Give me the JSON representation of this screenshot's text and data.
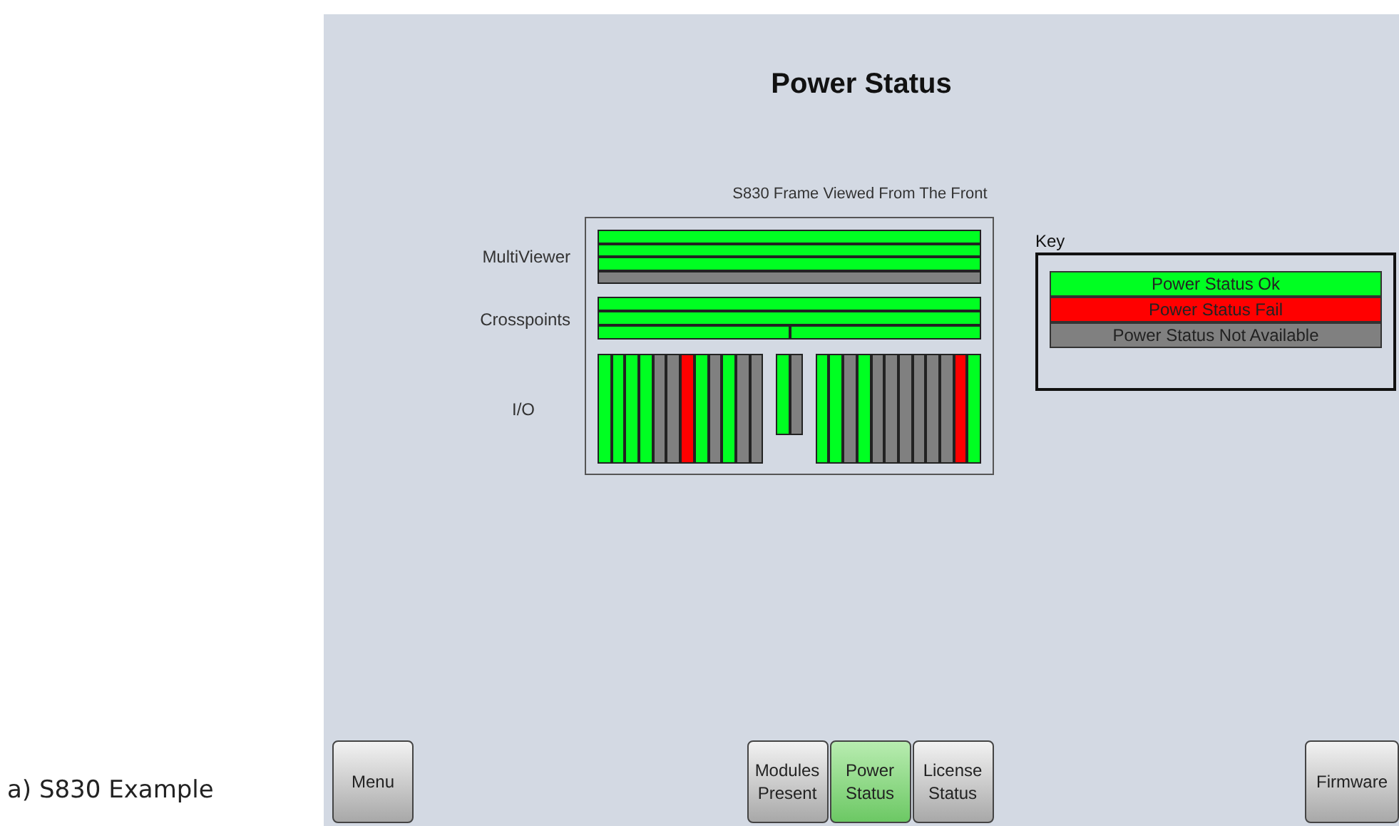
{
  "caption": "a) S830 Example",
  "title": "Power Status",
  "subtitle": "S830 Frame Viewed From The Front",
  "frame": {
    "multiviewer": {
      "label": "MultiViewer",
      "rows": [
        {
          "color": "#00ff22"
        },
        {
          "color": "#00ff22"
        },
        {
          "color": "#00ff22"
        },
        {
          "color": "#808080"
        }
      ]
    },
    "crosspoints": {
      "label": "Crosspoints",
      "rows": [
        [
          {
            "color": "#00ff22"
          }
        ],
        [
          {
            "color": "#00ff22"
          }
        ],
        [
          {
            "color": "#00ff22"
          },
          {
            "color": "#00ff22"
          }
        ]
      ]
    },
    "io": {
      "label": "I/O",
      "groups": [
        [
          {
            "color": "#00ff22"
          },
          {
            "color": "#00ff22"
          },
          {
            "color": "#00ff22"
          },
          {
            "color": "#00ff22"
          },
          {
            "color": "#808080"
          },
          {
            "color": "#808080"
          },
          {
            "color": "#ff0000"
          },
          {
            "color": "#00ff22"
          },
          {
            "color": "#808080"
          },
          {
            "color": "#00ff22"
          },
          {
            "color": "#808080"
          },
          {
            "color": "#808080"
          }
        ],
        [
          {
            "color": "#00ff22"
          },
          {
            "color": "#808080"
          }
        ],
        [
          {
            "color": "#00ff22"
          },
          {
            "color": "#00ff22"
          },
          {
            "color": "#808080"
          },
          {
            "color": "#00ff22"
          },
          {
            "color": "#808080"
          },
          {
            "color": "#808080"
          },
          {
            "color": "#808080"
          },
          {
            "color": "#808080"
          },
          {
            "color": "#808080"
          },
          {
            "color": "#808080"
          },
          {
            "color": "#ff0000"
          },
          {
            "color": "#00ff22"
          }
        ]
      ]
    }
  },
  "key": {
    "title": "Key",
    "entries": [
      {
        "label": "Power Status Ok",
        "color": "#00ff22"
      },
      {
        "label": "Power Status Fail",
        "color": "#ff0000"
      },
      {
        "label": "Power Status Not Available",
        "color": "#808080"
      }
    ]
  },
  "buttons": {
    "left": {
      "label": "Menu",
      "selected": false
    },
    "center": [
      {
        "label": "Modules\nPresent",
        "selected": false
      },
      {
        "label": "Power\nStatus",
        "selected": true
      },
      {
        "label": "License\nStatus",
        "selected": false
      }
    ],
    "right": {
      "label": "Firmware",
      "selected": false
    }
  }
}
